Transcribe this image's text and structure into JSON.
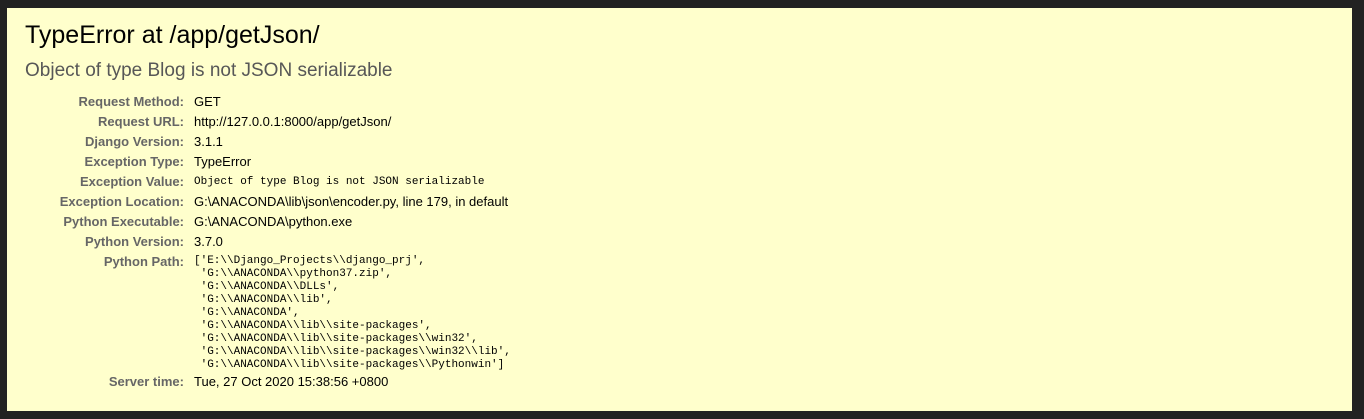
{
  "error": {
    "title": "TypeError at /app/getJson/",
    "message": "Object of type Blog is not JSON serializable"
  },
  "meta": {
    "request_method": {
      "label": "Request Method:",
      "value": "GET"
    },
    "request_url": {
      "label": "Request URL:",
      "value": "http://127.0.0.1:8000/app/getJson/"
    },
    "django_version": {
      "label": "Django Version:",
      "value": "3.1.1"
    },
    "exception_type": {
      "label": "Exception Type:",
      "value": "TypeError"
    },
    "exception_value": {
      "label": "Exception Value:",
      "value": "Object of type Blog is not JSON serializable"
    },
    "exception_location": {
      "label": "Exception Location:",
      "value": "G:\\ANACONDA\\lib\\json\\encoder.py, line 179, in default"
    },
    "python_executable": {
      "label": "Python Executable:",
      "value": "G:\\ANACONDA\\python.exe"
    },
    "python_version": {
      "label": "Python Version:",
      "value": "3.7.0"
    },
    "python_path": {
      "label": "Python Path:",
      "lines": [
        "['E:\\\\Django_Projects\\\\django_prj',",
        " 'G:\\\\ANACONDA\\\\python37.zip',",
        " 'G:\\\\ANACONDA\\\\DLLs',",
        " 'G:\\\\ANACONDA\\\\lib',",
        " 'G:\\\\ANACONDA',",
        " 'G:\\\\ANACONDA\\\\lib\\\\site-packages',",
        " 'G:\\\\ANACONDA\\\\lib\\\\site-packages\\\\win32',",
        " 'G:\\\\ANACONDA\\\\lib\\\\site-packages\\\\win32\\\\lib',",
        " 'G:\\\\ANACONDA\\\\lib\\\\site-packages\\\\Pythonwin']"
      ]
    },
    "server_time": {
      "label": "Server time:",
      "value": "Tue, 27 Oct 2020 15:38:56 +0800"
    }
  },
  "colors": {
    "page_background": "#222222",
    "panel_background": "#ffffcc",
    "label_text": "#666666",
    "subtitle_text": "#575757"
  }
}
